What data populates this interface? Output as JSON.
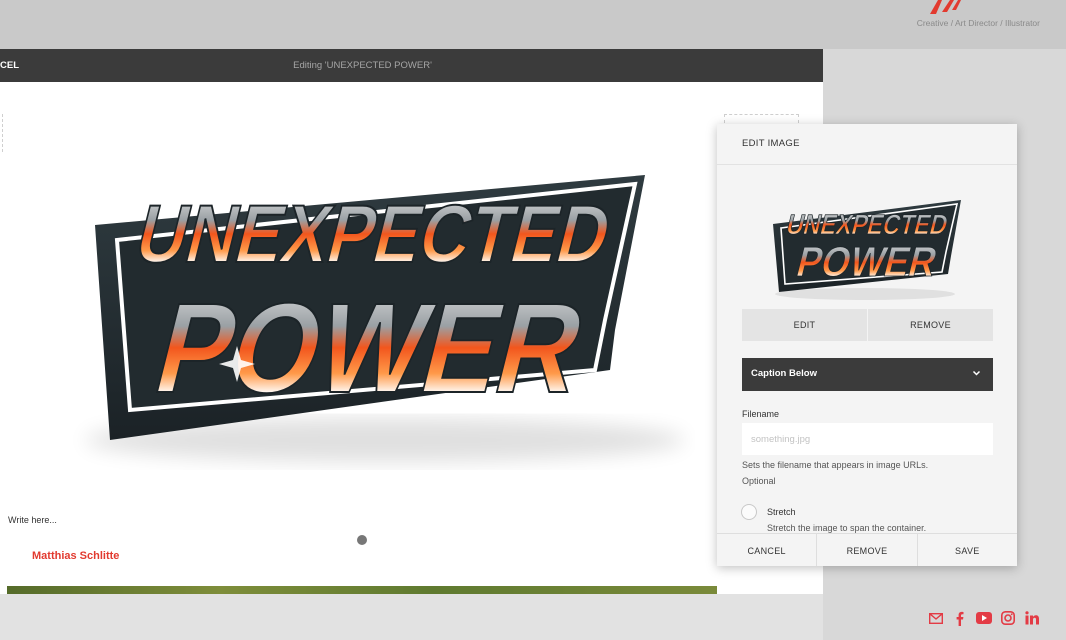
{
  "site": {
    "tagline": "Creative / Art Director / Illustrator"
  },
  "editbar": {
    "cancel_label": "CEL",
    "title": "Editing 'UNEXPECTED POWER'"
  },
  "content": {
    "hero_image": {
      "line1": "UNEXPECTED",
      "line2": "POWER",
      "accent": "#f2561d"
    },
    "caption_placeholder": "Write here...",
    "author": "Matthias Schlitte"
  },
  "panel": {
    "title": "EDIT IMAGE",
    "edit_label": "EDIT",
    "remove_label": "REMOVE",
    "caption_select": "Caption Below",
    "filename_label": "Filename",
    "filename_placeholder": "something.jpg",
    "filename_value": "",
    "filename_help_1": "Sets the filename that appears in image URLs.",
    "filename_help_2": "Optional",
    "stretch_label": "Stretch",
    "stretch_desc": "Stretch the image to span the container.",
    "footer": {
      "cancel": "CANCEL",
      "remove": "REMOVE",
      "save": "SAVE"
    }
  },
  "social": [
    "mail-icon",
    "facebook-icon",
    "youtube-icon",
    "instagram-icon",
    "linkedin-icon"
  ],
  "colors": {
    "accent": "#e23a2f",
    "toolbar": "#3b3b3b"
  }
}
